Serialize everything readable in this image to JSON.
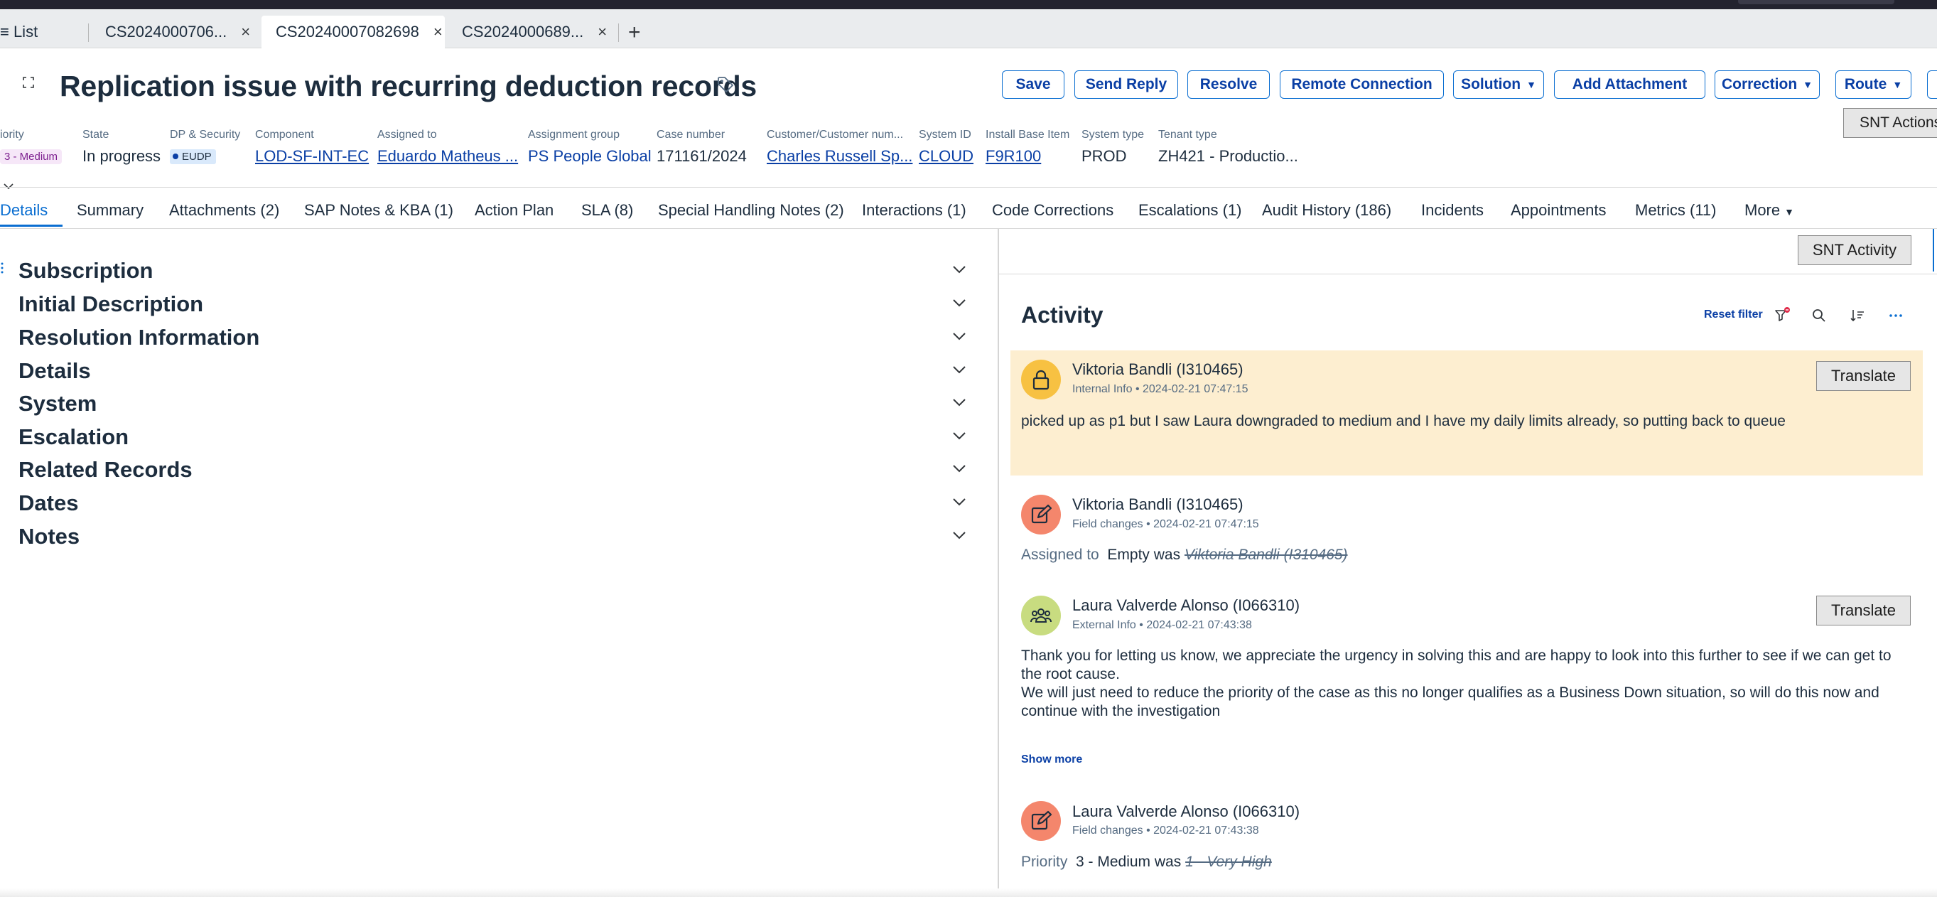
{
  "browser_tabs": [
    {
      "label": "≡ List"
    },
    {
      "label": "CS2024000706..."
    },
    {
      "label": "CS20240007082698"
    },
    {
      "label": "CS2024000689..."
    }
  ],
  "new_tab_label": "+",
  "close_glyph": "×",
  "header": {
    "title": "Replication issue with recurring deduction records",
    "buttons": {
      "save": "Save",
      "send_reply": "Send Reply",
      "resolve": "Resolve",
      "remote_connection": "Remote Connection",
      "solution": "Solution",
      "add_attachment": "Add Attachment",
      "correction": "Correction",
      "route": "Route"
    },
    "snt_actions": "SNT Actions"
  },
  "fields": {
    "priority": {
      "label": "iority",
      "value": "3 - Medium"
    },
    "state": {
      "label": "State",
      "value": "In progress"
    },
    "dp_security": {
      "label": "DP & Security",
      "value": "EUDP"
    },
    "component": {
      "label": "Component",
      "value": "LOD-SF-INT-EC"
    },
    "assigned_to": {
      "label": "Assigned to",
      "value": "Eduardo Matheus ..."
    },
    "assignment_group": {
      "label": "Assignment group",
      "value": "PS People Global"
    },
    "case_number": {
      "label": "Case number",
      "value": "171161/2024"
    },
    "customer": {
      "label": "Customer/Customer num...",
      "value": "Charles Russell Sp..."
    },
    "system_id": {
      "label": "System ID",
      "value": "CLOUD"
    },
    "install_base_item": {
      "label": "Install Base Item",
      "value": "F9R100"
    },
    "system_type": {
      "label": "System type",
      "value": "PROD"
    },
    "tenant_type": {
      "label": "Tenant type",
      "value": "ZH421 - Productio..."
    }
  },
  "nav_tabs": [
    "Details",
    "Summary",
    "Attachments (2)",
    "SAP Notes & KBA (1)",
    "Action Plan",
    "SLA (8)",
    "Special Handling Notes (2)",
    "Interactions (1)",
    "Code Corrections",
    "Escalations (1)",
    "Audit History (186)",
    "Incidents",
    "Appointments",
    "Metrics (11)",
    "More"
  ],
  "sections": [
    "Subscription",
    "Initial Description",
    "Resolution Information",
    "Details",
    "System",
    "Escalation",
    "Related Records",
    "Dates",
    "Notes"
  ],
  "activity": {
    "snt_activity": "SNT Activity",
    "title": "Activity",
    "reset_filter": "Reset filter",
    "show_more": "Show more",
    "translate": "Translate",
    "entries": [
      {
        "author": "Viktoria Bandli (I310465)",
        "meta": "Internal Info • 2024-02-21 07:47:15",
        "body": "picked up as p1 but I saw Laura downgraded to medium and I have my daily limits already, so putting back to queue"
      },
      {
        "author": "Viktoria Bandli (I310465)",
        "meta": "Field changes • 2024-02-21 07:47:15",
        "change_field": "Assigned to",
        "change_new": "Empty was",
        "change_old": "Viktoria Bandli (I310465)"
      },
      {
        "author": "Laura Valverde Alonso (I066310)",
        "meta": "External Info • 2024-02-21 07:43:38",
        "body_line1": "Thank you for letting us know, we appreciate the urgency in solving this and are happy to look into this further to see if we can get to the root cause.",
        "body_line2": "We will just need to reduce the priority of the case as this no longer qualifies as a Business Down situation, so will do this now and continue with the investigation"
      },
      {
        "author": "Laura Valverde Alonso (I066310)",
        "meta": "Field changes • 2024-02-21 07:43:38",
        "change_field": "Priority",
        "change_new": "3 - Medium was",
        "change_old": "1 - Very High"
      }
    ]
  },
  "colors": {
    "accent": "#0a6ed1",
    "link": "#0a3fa5",
    "internal_bg": "#fdeed0",
    "avatar_lock": "#f7c142",
    "avatar_edit": "#f4866c",
    "avatar_people": "#c8dc80"
  }
}
